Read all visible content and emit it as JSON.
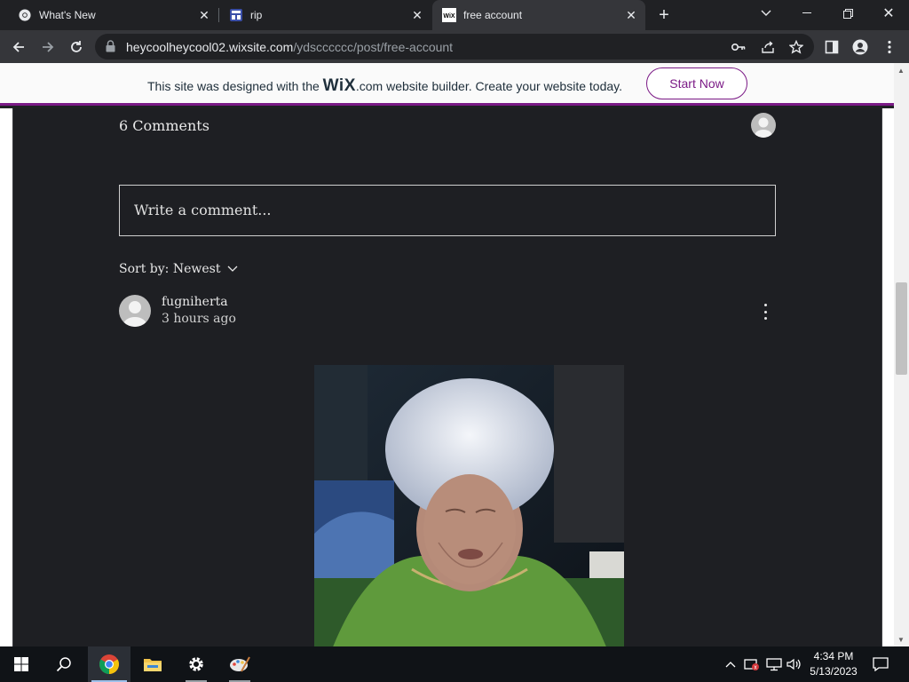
{
  "browser": {
    "tabs": [
      {
        "title": "What's New",
        "icon": "chrome-icon",
        "active": false
      },
      {
        "title": "rip",
        "icon": "page-icon",
        "active": false
      },
      {
        "title": "free account",
        "icon": "wix-icon",
        "active": true
      }
    ],
    "url_host": "heycoolheycool02.wixsite.com",
    "url_path": "/ydscccccc/post/free-account"
  },
  "wix_banner": {
    "text_before": "This site was designed with the ",
    "logo": "WiX",
    "text_after": ".com website builder. Create your website today.",
    "cta_label": "Start Now",
    "accent_color": "#7b1a86"
  },
  "comments": {
    "title": "6 Comments",
    "write_placeholder": "Write a comment...",
    "sort_label": "Sort by: Newest",
    "items": [
      {
        "username": "fugniherta",
        "time": "3 hours ago"
      }
    ]
  },
  "taskbar": {
    "apps": [
      "windows-start-icon",
      "search-icon",
      "chrome-icon",
      "file-explorer-icon",
      "settings-icon",
      "paint-icon"
    ],
    "time": "4:34 PM",
    "date": "5/13/2023"
  }
}
